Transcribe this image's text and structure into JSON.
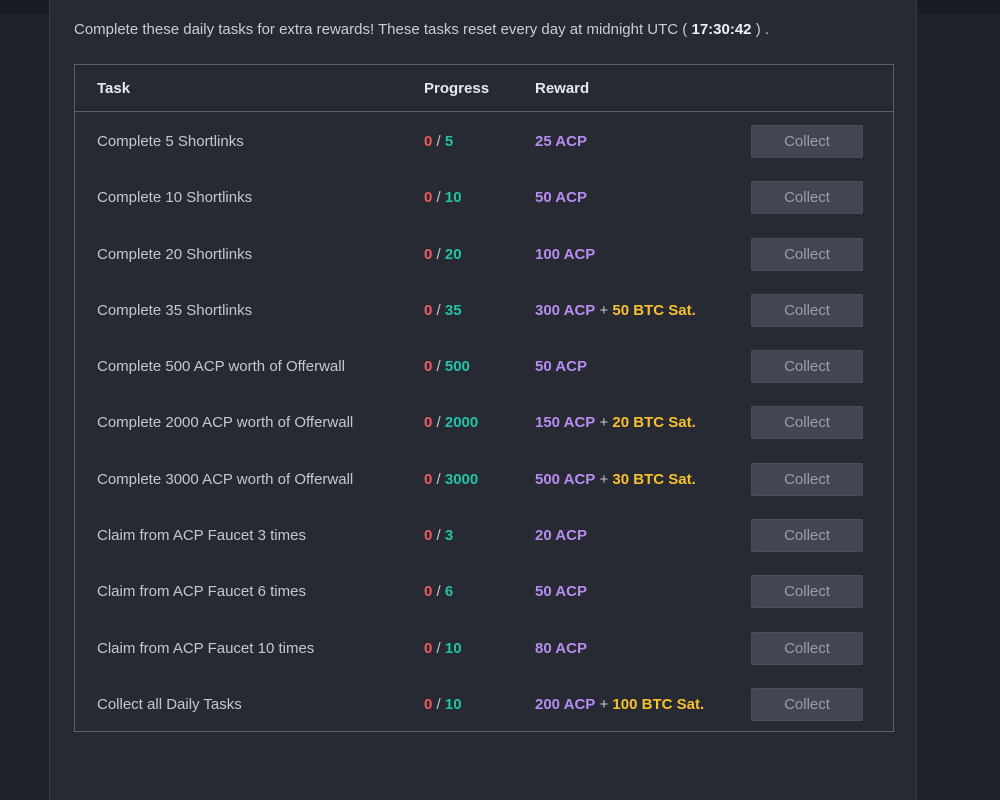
{
  "intro": {
    "text_before": "Complete these daily tasks for extra rewards! These tasks reset every day at midnight UTC (",
    "countdown": "17:30:42",
    "text_after": ") ."
  },
  "table": {
    "headers": {
      "task": "Task",
      "progress": "Progress",
      "reward": "Reward"
    },
    "rows": [
      {
        "task": "Complete 5 Shortlinks",
        "current": "0",
        "goal": "5",
        "acp": "25 ACP",
        "btc": "",
        "button": "Collect"
      },
      {
        "task": "Complete 10 Shortlinks",
        "current": "0",
        "goal": "10",
        "acp": "50 ACP",
        "btc": "",
        "button": "Collect"
      },
      {
        "task": "Complete 20 Shortlinks",
        "current": "0",
        "goal": "20",
        "acp": "100 ACP",
        "btc": "",
        "button": "Collect"
      },
      {
        "task": "Complete 35 Shortlinks",
        "current": "0",
        "goal": "35",
        "acp": "300 ACP",
        "btc": "50 BTC Sat.",
        "button": "Collect"
      },
      {
        "task": "Complete 500 ACP worth of Offerwall",
        "current": "0",
        "goal": "500",
        "acp": "50 ACP",
        "btc": "",
        "button": "Collect"
      },
      {
        "task": "Complete 2000 ACP worth of Offerwall",
        "current": "0",
        "goal": "2000",
        "acp": "150 ACP",
        "btc": "20 BTC Sat.",
        "button": "Collect"
      },
      {
        "task": "Complete 3000 ACP worth of Offerwall",
        "current": "0",
        "goal": "3000",
        "acp": "500 ACP",
        "btc": "30 BTC Sat.",
        "button": "Collect"
      },
      {
        "task": "Claim from ACP Faucet 3 times",
        "current": "0",
        "goal": "3",
        "acp": "20 ACP",
        "btc": "",
        "button": "Collect"
      },
      {
        "task": "Claim from ACP Faucet 6 times",
        "current": "0",
        "goal": "6",
        "acp": "50 ACP",
        "btc": "",
        "button": "Collect"
      },
      {
        "task": "Claim from ACP Faucet 10 times",
        "current": "0",
        "goal": "10",
        "acp": "80 ACP",
        "btc": "",
        "button": "Collect"
      },
      {
        "task": "Collect all Daily Tasks",
        "current": "0",
        "goal": "10",
        "acp": "200 ACP",
        "btc": "100 BTC Sat.",
        "button": "Collect"
      }
    ]
  },
  "colors": {
    "progress_current": "#f15a5f",
    "progress_goal": "#22c3a6",
    "reward_acp": "#b78cf0",
    "reward_btc": "#f6c12f"
  }
}
